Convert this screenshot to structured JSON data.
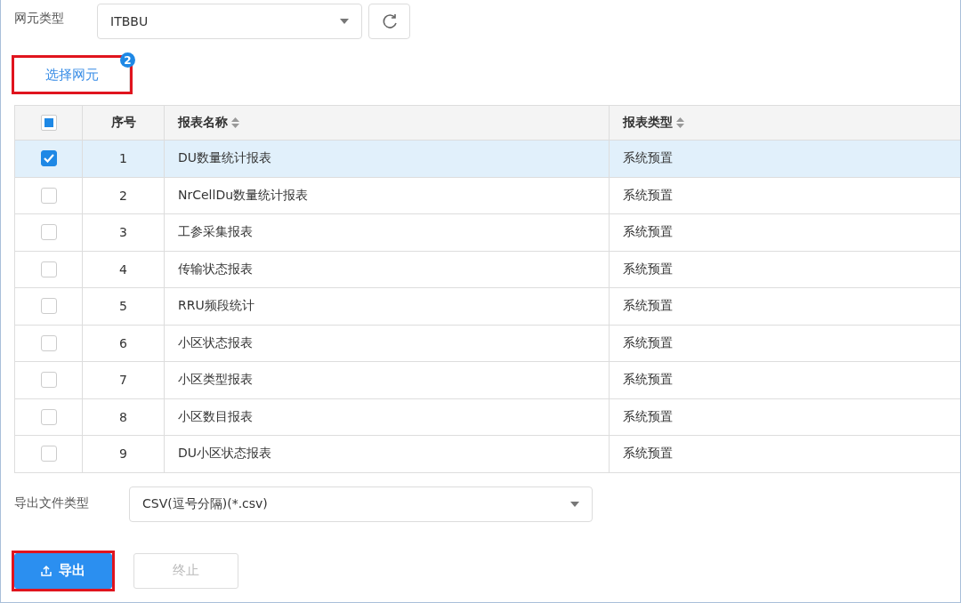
{
  "ne_type": {
    "label": "网元类型",
    "value": "ITBBU"
  },
  "tab": {
    "label": "选择网元",
    "badge": "2",
    "selected": true,
    "highlighted": true
  },
  "table": {
    "header_checkbox": {
      "indeterminate": true
    },
    "columns": [
      {
        "label": "序号",
        "sortable": false
      },
      {
        "label": "报表名称",
        "sortable": true
      },
      {
        "label": "报表类型",
        "sortable": true
      }
    ],
    "rows": [
      {
        "no": "1",
        "name": "DU数量统计报表",
        "type": "系统预置",
        "selected": true
      },
      {
        "no": "2",
        "name": "NrCellDu数量统计报表",
        "type": "系统预置",
        "selected": false
      },
      {
        "no": "3",
        "name": "工参采集报表",
        "type": "系统预置",
        "selected": false
      },
      {
        "no": "4",
        "name": "传输状态报表",
        "type": "系统预置",
        "selected": false
      },
      {
        "no": "5",
        "name": "RRU频段统计",
        "type": "系统预置",
        "selected": false
      },
      {
        "no": "6",
        "name": "小区状态报表",
        "type": "系统预置",
        "selected": false
      },
      {
        "no": "7",
        "name": "小区类型报表",
        "type": "系统预置",
        "selected": false
      },
      {
        "no": "8",
        "name": "小区数目报表",
        "type": "系统预置",
        "selected": false
      },
      {
        "no": "9",
        "name": "DU小区状态报表",
        "type": "系统预置",
        "selected": false
      }
    ]
  },
  "export_type": {
    "label": "导出文件类型",
    "value": "CSV(逗号分隔)(*.csv)"
  },
  "buttons": [
    {
      "kind": "primary",
      "label": "导出",
      "disabled": false,
      "highlighted": true
    },
    {
      "kind": "secondary",
      "label": "终止",
      "disabled": true,
      "highlighted": false
    }
  ]
}
